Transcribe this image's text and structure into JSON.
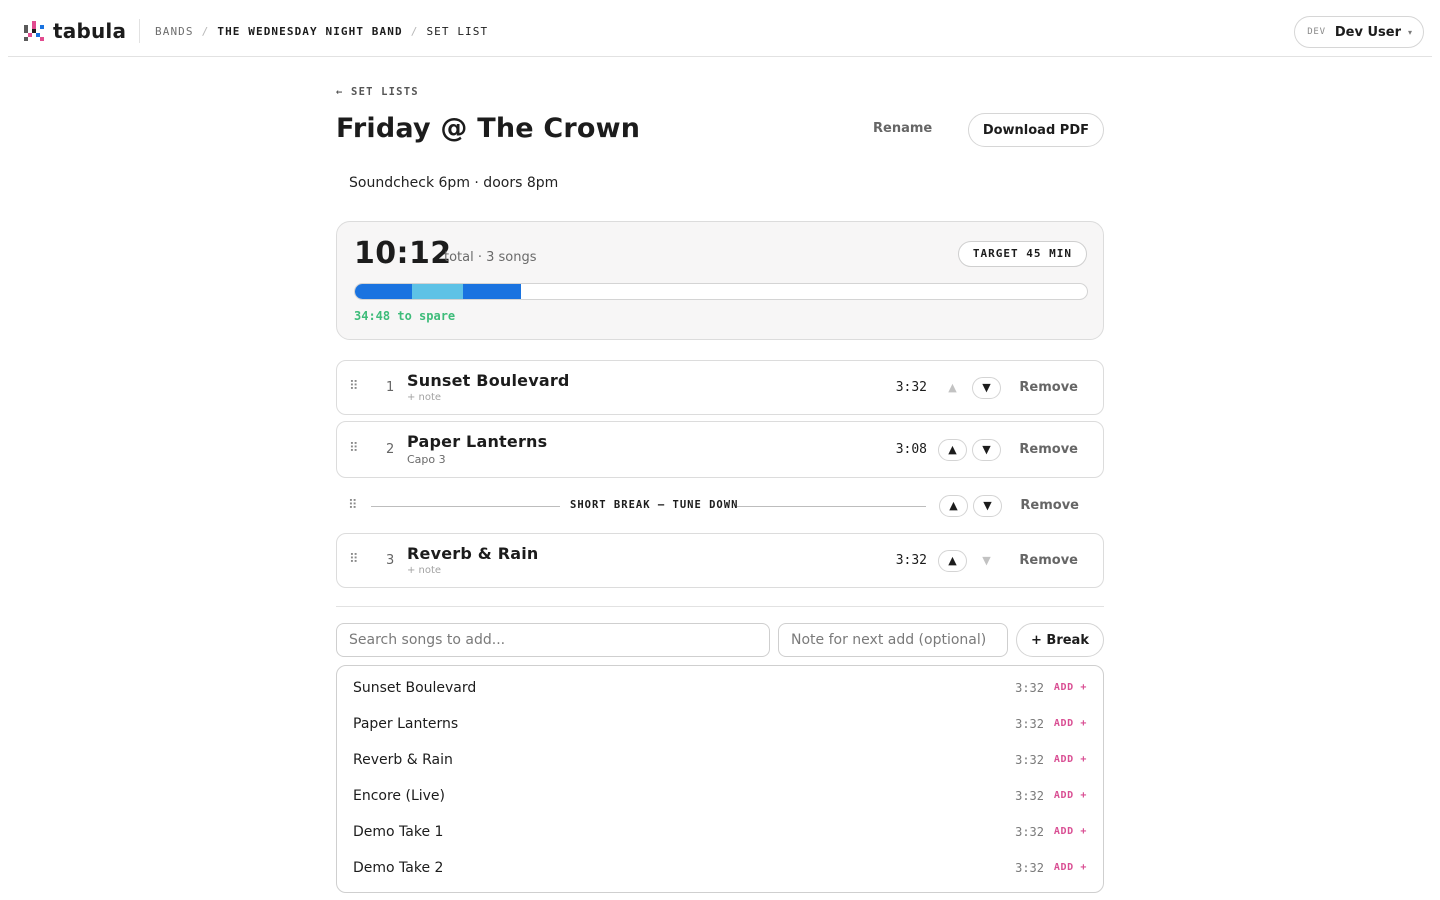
{
  "app": {
    "name": "tabula"
  },
  "breadcrumb": {
    "bands": "BANDS",
    "band": "THE WEDNESDAY NIGHT BAND",
    "page": "SET LIST",
    "sep": "/"
  },
  "user": {
    "env": "DEV",
    "name": "Dev User",
    "caret": "▾"
  },
  "back_link": "← SET LISTS",
  "set_list": {
    "title": "Friday @ The Crown",
    "note": "Soundcheck 6pm · doors 8pm",
    "rename_label": "Rename",
    "download_label": "Download PDF"
  },
  "summary": {
    "total": "10:12",
    "meta": "total · 3 songs",
    "target": "TARGET 45 MIN",
    "target_minutes": 45,
    "spare": "34:48 to spare",
    "segments": [
      {
        "kind": "song",
        "seconds": 212,
        "color": "#1a73e0"
      },
      {
        "kind": "break",
        "seconds": 188,
        "color": "#5ec2e6"
      },
      {
        "kind": "song",
        "seconds": 212,
        "color": "#1a73e0"
      }
    ],
    "spare_color": "#3ebc7a"
  },
  "rows": [
    {
      "type": "song",
      "num": "1",
      "title": "Sunset Boulevard",
      "note": "+ note",
      "note_is_placeholder": true,
      "duration": "3:32",
      "up_disabled": true,
      "down_disabled": false,
      "remove": "Remove"
    },
    {
      "type": "song",
      "num": "2",
      "title": "Paper Lanterns",
      "note": "Capo 3",
      "note_is_placeholder": false,
      "duration": "3:08",
      "up_disabled": false,
      "down_disabled": false,
      "remove": "Remove"
    },
    {
      "type": "break",
      "label": "SHORT BREAK — TUNE DOWN",
      "up_disabled": false,
      "down_disabled": false,
      "remove": "Remove"
    },
    {
      "type": "song",
      "num": "3",
      "title": "Reverb & Rain",
      "note": "+ note",
      "note_is_placeholder": true,
      "duration": "3:32",
      "up_disabled": false,
      "down_disabled": true,
      "remove": "Remove"
    }
  ],
  "controls": {
    "grip": "⠿",
    "up": "▲",
    "down": "▼"
  },
  "add": {
    "search_placeholder": "Search songs to add...",
    "note_placeholder": "Note for next add (optional)",
    "break_label": "+ Break"
  },
  "results": [
    {
      "title": "Sunset Boulevard",
      "duration": "3:32",
      "add": "ADD +"
    },
    {
      "title": "Paper Lanterns",
      "duration": "3:32",
      "add": "ADD +"
    },
    {
      "title": "Reverb & Rain",
      "duration": "3:32",
      "add": "ADD +"
    },
    {
      "title": "Encore (Live)",
      "duration": "3:32",
      "add": "ADD +"
    },
    {
      "title": "Demo Take 1",
      "duration": "3:32",
      "add": "ADD +"
    },
    {
      "title": "Demo Take 2",
      "duration": "3:32",
      "add": "ADD +"
    }
  ]
}
